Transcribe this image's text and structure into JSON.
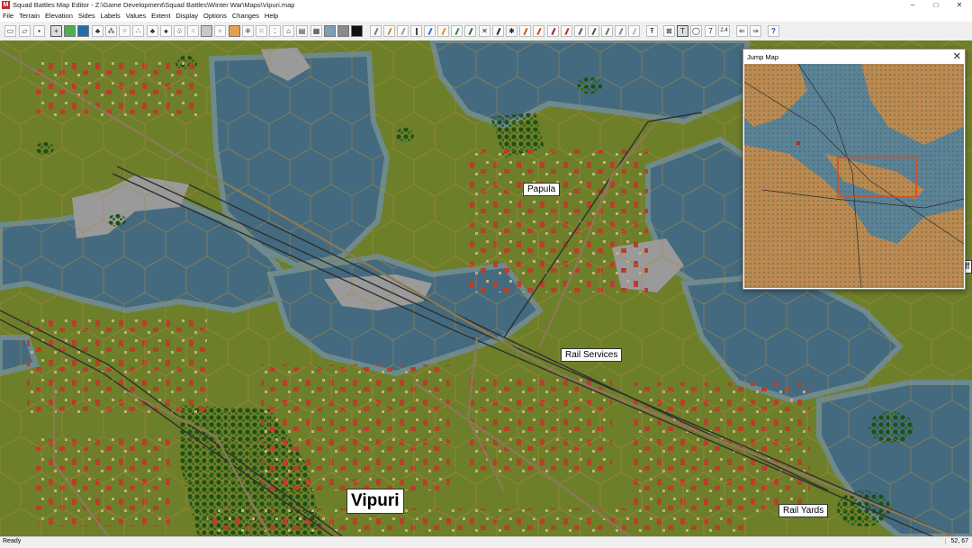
{
  "window": {
    "app_icon_glyph": "M",
    "title": "Squad Battles Map Editor - Z:\\Game Development\\Squad Battles\\Winter War\\Maps\\Vipuri.map",
    "minimize_glyph": "–",
    "maximize_glyph": "□",
    "close_glyph": "✕"
  },
  "menu": [
    "File",
    "Terrain",
    "Elevation",
    "Sides",
    "Labels",
    "Values",
    "Extent",
    "Display",
    "Options",
    "Changes",
    "Help"
  ],
  "toolbar": {
    "text_tool_glyph": "T",
    "circle_tool_glyph": "◯",
    "seven_label": "7",
    "twofour_label": "2,4",
    "left_glyph": "⇐",
    "right_glyph": "⇒",
    "help_glyph": "?"
  },
  "map": {
    "labels": {
      "papula": "Papula",
      "rail_services": "Rail Services",
      "vipuri": "Vipuri",
      "rail_yards": "Rail Yards",
      "edge_fragment": "ff"
    },
    "colors": {
      "terrain": "#6e7f2a",
      "water": "#446a80",
      "shore": "#6e8a8c",
      "urban": "#9a9a9a",
      "forest": "#1f4f14",
      "road": "#8a7a55",
      "rail": "#2f2f2f",
      "roof_red": "#b5412a",
      "roof_grey": "#6a6a6a"
    }
  },
  "jump_map": {
    "title": "Jump Map",
    "close_glyph": "✕",
    "colors": {
      "land": "#c68a4a",
      "water": "#5b8297",
      "viewport_frame": "#e04a1a"
    }
  },
  "status": {
    "left": "Ready",
    "coords": "52, 67"
  }
}
